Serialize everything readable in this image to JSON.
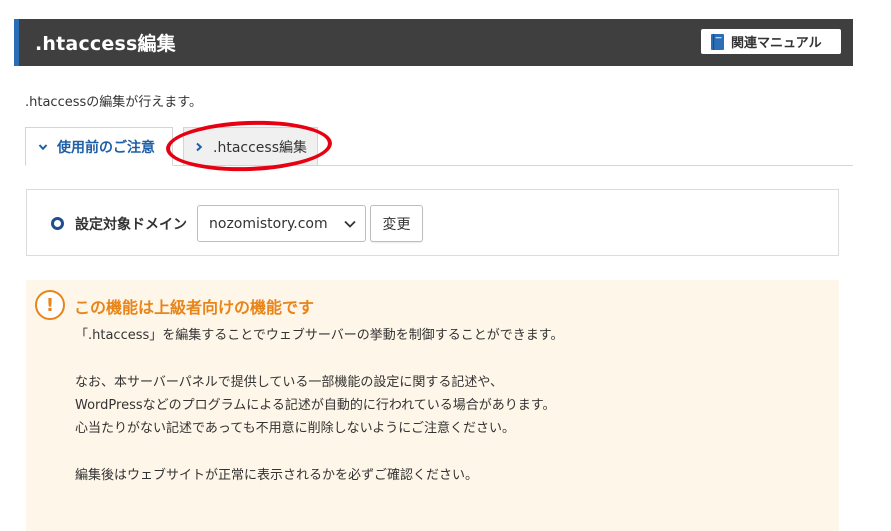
{
  "header": {
    "title": ".htaccess編集",
    "manual_button": {
      "label": "関連マニュアル",
      "icon": "book-icon"
    }
  },
  "description": ".htaccessの編集が行えます。",
  "tabs": [
    {
      "label": "使用前のご注意",
      "active": true,
      "icon": "chevron-down-icon"
    },
    {
      "label": ".htaccess編集",
      "active": false,
      "icon": "chevron-right-icon"
    }
  ],
  "domain_selector": {
    "label": "設定対象ドメイン",
    "selected": "nozomistory.com",
    "change_button": "変更"
  },
  "notice": {
    "title": "この機能は上級者向けの機能です",
    "icon_glyph": "!",
    "lines": [
      "「.htaccess」を編集することでウェブサーバーの挙動を制御することができます。",
      "なお、本サーバーパネルで提供している一部機能の設定に関する記述や、",
      "WordPressなどのプログラムによる記述が自動的に行われている場合があります。",
      "心当たりがない記述であっても不用意に削除しないようにご注意ください。",
      "編集後はウェブサイトが正常に表示されるかを必ずご確認ください。"
    ]
  },
  "colors": {
    "header_bg": "#3f3f3f",
    "header_accent": "#2c6eb5",
    "active_tab_text": "#1f5fa8",
    "warning": "#e8851a",
    "notice_bg": "#fef6e9",
    "highlight_circle": "#e60012"
  }
}
